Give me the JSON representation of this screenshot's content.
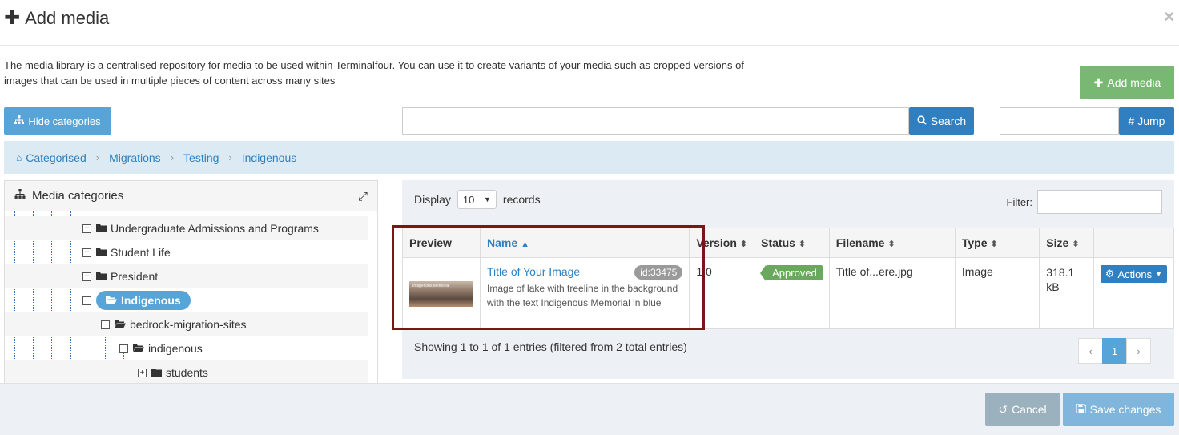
{
  "dialog": {
    "title": "Add media",
    "close": "×",
    "intro": "The media library is a centralised repository for media to be used within Terminalfour. You can use it to create variants of your media such as cropped versions of images that can be used in multiple pieces of content across many sites"
  },
  "toolbar": {
    "add_media": "Add media",
    "hide_categories": "Hide categories",
    "search_label": "Search",
    "search_value": "",
    "jump_label": "# Jump",
    "jump_value": ""
  },
  "breadcrumb": [
    "Categorised",
    "Migrations",
    "Testing",
    "Indigenous"
  ],
  "categories": {
    "title": "Media categories",
    "items": [
      {
        "label": "Undergraduate Admissions and Programs",
        "state": "collapsed"
      },
      {
        "label": "Student Life",
        "state": "collapsed"
      },
      {
        "label": "President",
        "state": "collapsed"
      },
      {
        "label": "Indigenous",
        "state": "expanded",
        "selected": true
      },
      {
        "label": "bedrock-migration-sites",
        "state": "expanded"
      },
      {
        "label": "indigenous",
        "state": "expanded"
      },
      {
        "label": "students",
        "state": "collapsed"
      }
    ]
  },
  "table": {
    "display_label": "Display",
    "page_size": "10",
    "records_label": "records",
    "filter_label": "Filter:",
    "filter_value": "",
    "columns": [
      "Preview",
      "Name",
      "Version",
      "Status",
      "Filename",
      "Type",
      "Size",
      ""
    ],
    "rows": [
      {
        "preview_caption": "Indigenous Memorial",
        "name": "Title of Your Image",
        "id": "id:33475",
        "description": "Image of lake with treeline in the background with the text Indigenous Memorial in blue",
        "version": "1.0",
        "status": "Approved",
        "filename": "Title of...ere.jpg",
        "type": "Image",
        "size": "318.1 kB",
        "actions": "Actions"
      }
    ],
    "showing": "Showing 1 to 1 of 1 entries (filtered from 2 total entries)",
    "pager": {
      "prev": "‹",
      "current": "1",
      "next": "›"
    }
  },
  "footer": {
    "cancel": "Cancel",
    "save": "Save changes"
  },
  "colors": {
    "primary": "#2f7fc1",
    "accent_light": "#56a4d8",
    "success": "#79b873",
    "approved": "#6aa85e",
    "highlight": "#7a1616"
  }
}
